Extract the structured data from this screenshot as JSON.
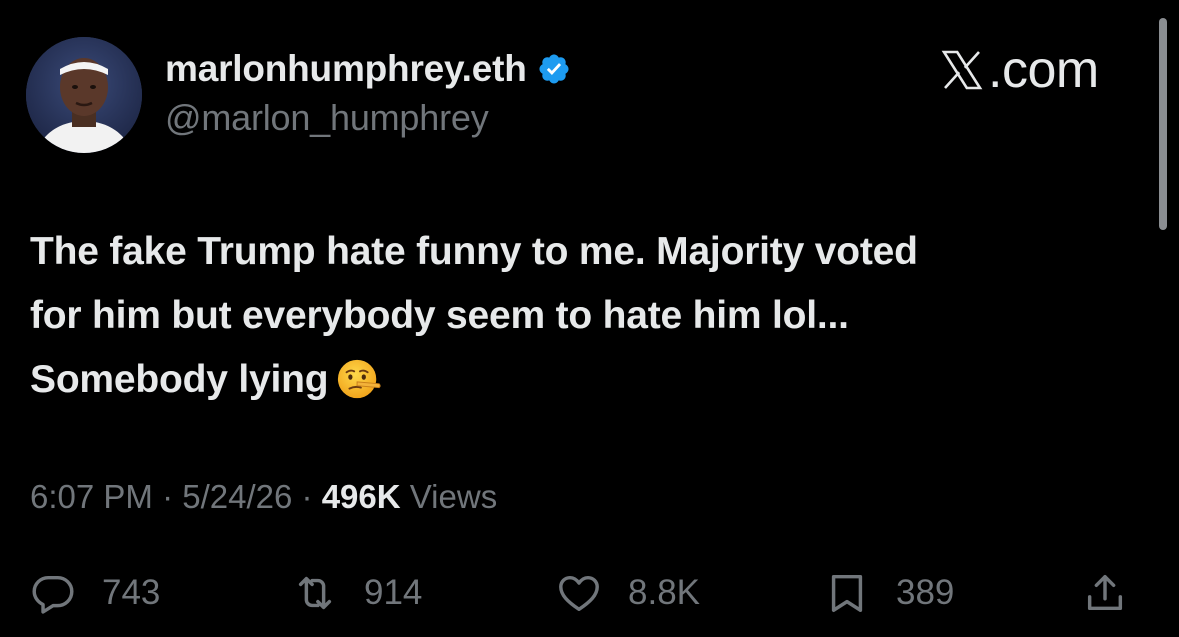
{
  "header": {
    "display_name": "marlonhumphrey.eth",
    "handle": "@marlon_humphrey",
    "brand_suffix": ".com",
    "verified_color": "#1d9bf0",
    "avatar_icon": "profile-photo"
  },
  "tweet": {
    "lines": [
      "The fake Trump hate funny to me. Majority voted",
      "for him but everybody seem to hate him lol...",
      "Somebody lying"
    ],
    "emoji_icon": "lying-face-emoji"
  },
  "meta": {
    "time": "6:07 PM",
    "separator": "·",
    "date": "5/24/26",
    "views_count": "496K",
    "views_label": "Views"
  },
  "actions": {
    "reply_count": "743",
    "repost_count": "914",
    "like_count": "8.8K",
    "bookmark_count": "389"
  },
  "colors": {
    "background": "#000000",
    "primary_text": "#e7e9ea",
    "secondary_text": "#71767b"
  }
}
